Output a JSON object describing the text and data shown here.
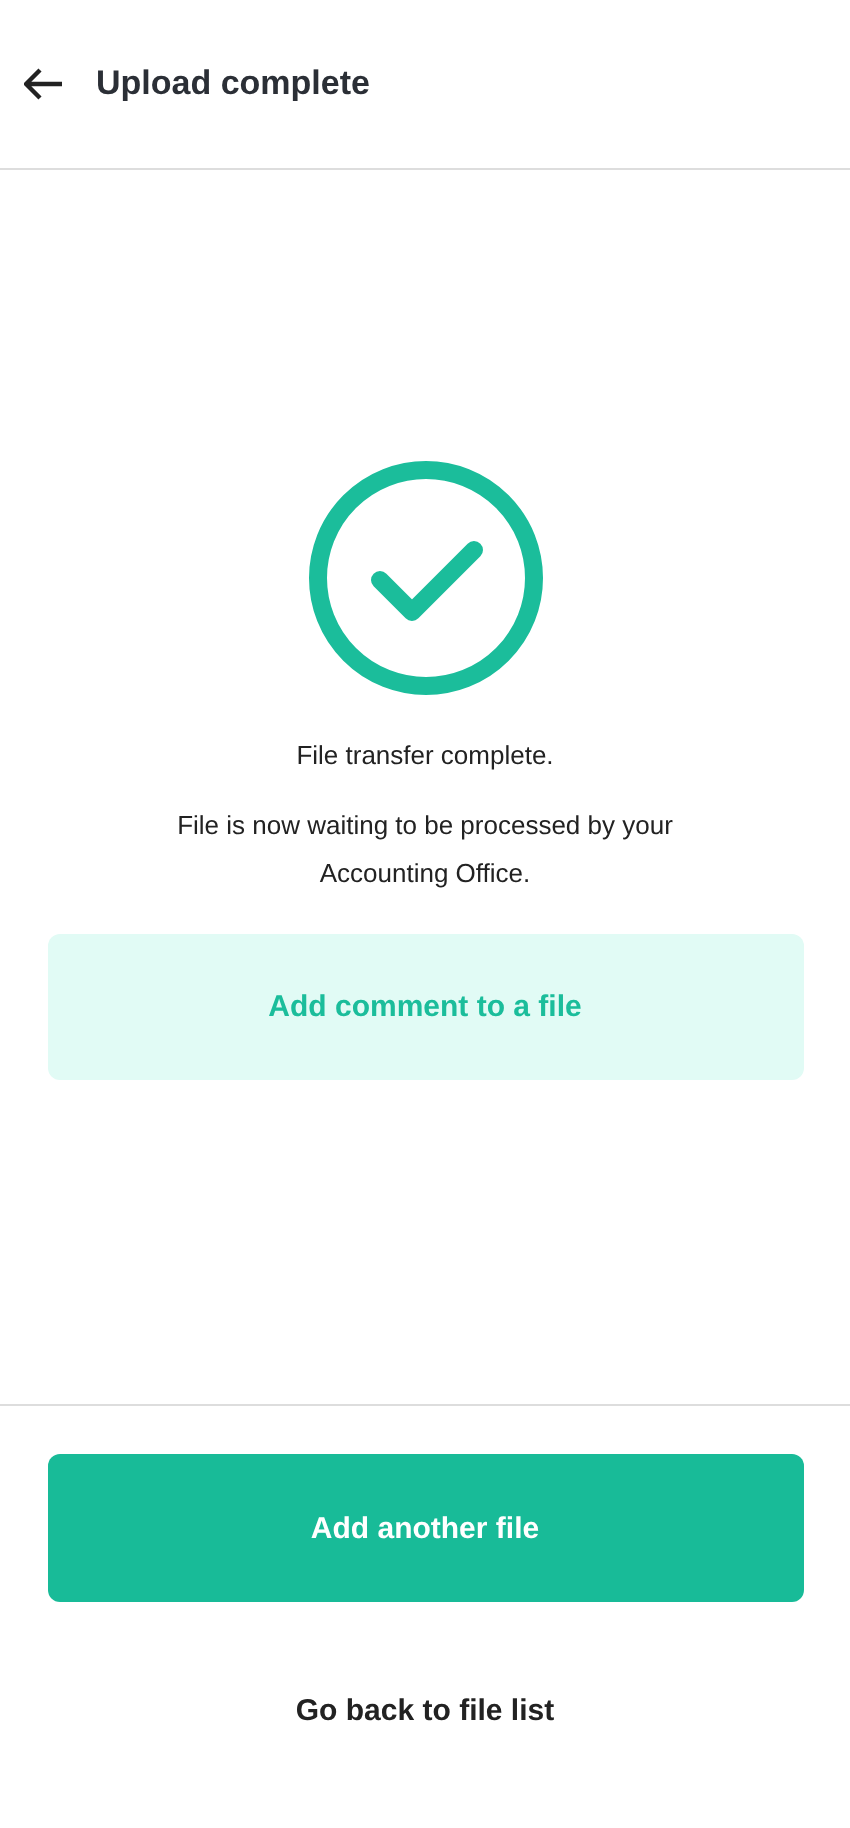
{
  "header": {
    "title": "Upload complete"
  },
  "status": {
    "kind": "success",
    "message": "File transfer complete.",
    "detail": "File is now waiting to be processed by your Accounting Office."
  },
  "comment_button": {
    "label": "Add comment to a file"
  },
  "footer": {
    "primary_button": {
      "label": "Add another file"
    },
    "link": {
      "label": "Go back to file list"
    }
  }
}
